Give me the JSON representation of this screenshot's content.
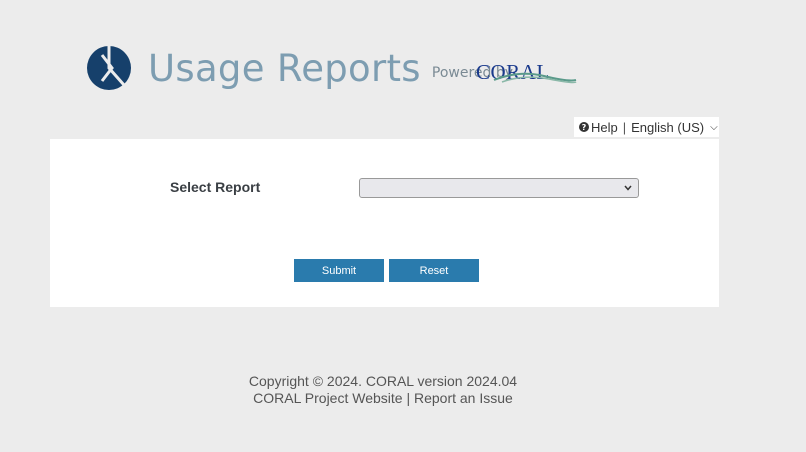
{
  "header": {
    "title": "Usage Reports",
    "powered_by": "Powered by",
    "coral_logo_text": "CORAL"
  },
  "toolbar": {
    "help_label": "Help",
    "separator": "|",
    "language": "English (US)"
  },
  "form": {
    "select_label": "Select Report",
    "select_value": "",
    "submit_label": "Submit",
    "reset_label": "Reset"
  },
  "footer": {
    "copyright": "Copyright © 2024. CORAL version 2024.04",
    "project_website": "CORAL Project Website",
    "separator": "|",
    "report_issue": "Report an Issue"
  },
  "colors": {
    "accent": "#2a7bad",
    "title": "#7d9db1",
    "logo_dark": "#16406b"
  }
}
